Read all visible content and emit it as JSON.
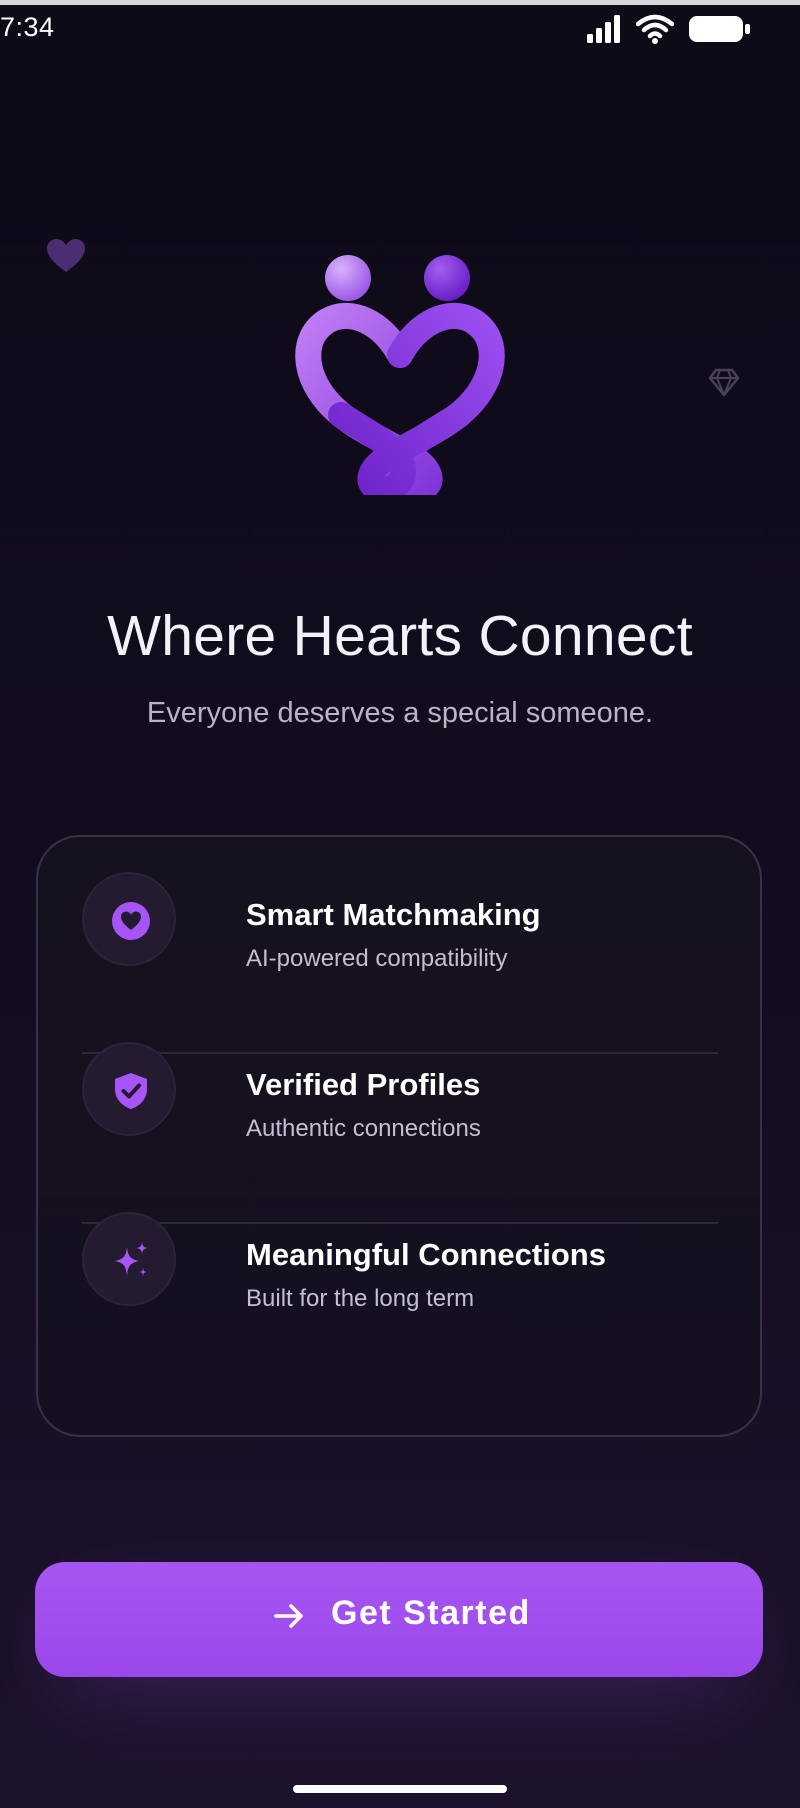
{
  "status_bar": {
    "time": "7:34",
    "icons": [
      "signal-icon",
      "wifi-icon",
      "battery-icon"
    ]
  },
  "decorations": [
    "heart-icon",
    "diamond-icon"
  ],
  "logo": {
    "icon": "hearts-connect-logo"
  },
  "hero": {
    "title": "Where Hearts Connect",
    "subtitle": "Everyone deserves a special someone."
  },
  "features": [
    {
      "icon": "heart-icon",
      "title": "Smart Matchmaking",
      "description": "AI-powered compatibility"
    },
    {
      "icon": "shield-check-icon",
      "title": "Verified Profiles",
      "description": "Authentic connections"
    },
    {
      "icon": "sparkles-icon",
      "title": "Meaningful Connections",
      "description": "Built for the long term"
    }
  ],
  "cta": {
    "icon": "arrow-right-icon",
    "label": "Get Started"
  },
  "colors": {
    "background": "#120c1d",
    "accent": "#a855f7",
    "card_border": "#3a3146",
    "icon_circle": "#241b31",
    "text_primary": "#ffffff",
    "text_secondary": "#bdb3c9"
  }
}
